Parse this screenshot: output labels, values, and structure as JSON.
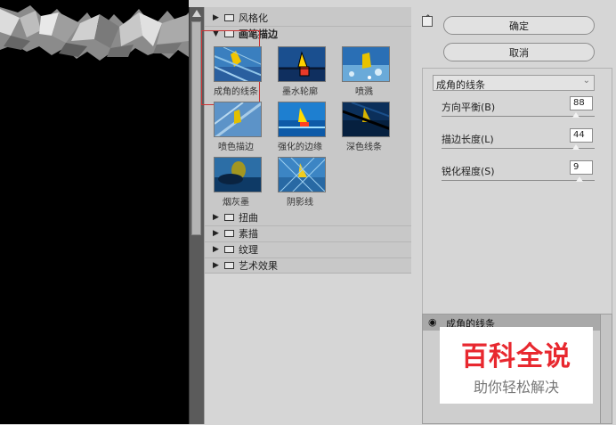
{
  "dialog": {
    "ok_label": "确定",
    "cancel_label": "取消"
  },
  "gallery": {
    "categories_top": [
      {
        "label": "风格化",
        "state": "collapsed"
      },
      {
        "label": "画笔描边",
        "state": "expanded"
      }
    ],
    "thumbnails": [
      {
        "caption": "成角的线条",
        "selected": true
      },
      {
        "caption": "墨水轮廓",
        "selected": false
      },
      {
        "caption": "喷溅",
        "selected": false
      },
      {
        "caption": "喷色描边",
        "selected": false
      },
      {
        "caption": "强化的边缘",
        "selected": false
      },
      {
        "caption": "深色线条",
        "selected": false
      },
      {
        "caption": "烟灰墨",
        "selected": false
      },
      {
        "caption": "阴影线",
        "selected": false
      }
    ],
    "categories_bottom": [
      {
        "label": "扭曲",
        "state": "collapsed"
      },
      {
        "label": "素描",
        "state": "collapsed"
      },
      {
        "label": "纹理",
        "state": "collapsed"
      },
      {
        "label": "艺术效果",
        "state": "collapsed"
      }
    ]
  },
  "settings": {
    "filter_select": "成角的线条",
    "params": [
      {
        "label": "方向平衡(B)",
        "value": "88",
        "max": 100
      },
      {
        "label": "描边长度(L)",
        "value": "44",
        "max": 50
      },
      {
        "label": "锐化程度(S)",
        "value": "9",
        "max": 10
      }
    ]
  },
  "layers": {
    "items": [
      {
        "label": "成角的线条",
        "visible": true
      }
    ]
  },
  "watermark": {
    "title": "百科全说",
    "subtitle": "助你轻松解决"
  },
  "icons": {
    "category_arrow_collapsed": "triangle-right-icon",
    "category_arrow_expanded": "triangle-down-icon",
    "folder": "folder-icon",
    "eye": "eye-icon",
    "collapse": "collapse-panel-icon"
  }
}
